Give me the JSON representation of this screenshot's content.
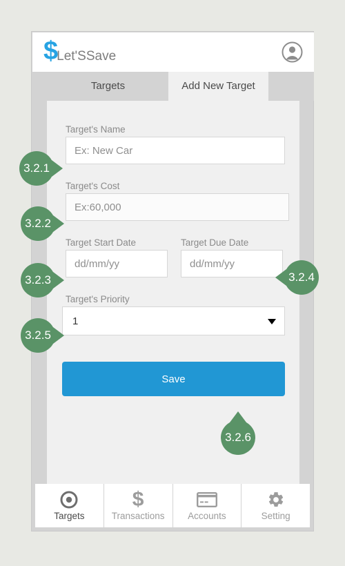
{
  "app": {
    "brand_symbol": "$",
    "brand_name": "Let'SSave",
    "avatar_icon": "user-avatar-icon"
  },
  "tabs": [
    {
      "label": "Targets",
      "active": false
    },
    {
      "label": "Add New Target",
      "active": true
    }
  ],
  "form": {
    "fields": [
      {
        "label": "Target's Name",
        "placeholder": "Ex: New Car",
        "value": ""
      },
      {
        "label": "Target's Cost",
        "placeholder": "Ex:60,000",
        "value": ""
      },
      {
        "label": "Target Start Date",
        "placeholder": "dd/mm/yy",
        "value": ""
      },
      {
        "label": "Target Due Date",
        "placeholder": "dd/mm/yy",
        "value": ""
      }
    ],
    "priority": {
      "label": "Target's Priority",
      "selected": "1",
      "caret_icon": "chevron-down-icon"
    },
    "save_label": "Save"
  },
  "bottom_nav": [
    {
      "label": "Targets",
      "icon": "target-bullseye-icon",
      "active": true
    },
    {
      "label": "Transactions",
      "icon": "dollar-sign-icon",
      "active": false
    },
    {
      "label": "Accounts",
      "icon": "credit-card-icon",
      "active": false
    },
    {
      "label": "Setting",
      "icon": "gear-icon",
      "active": false
    }
  ],
  "annotations": [
    {
      "id": "3.2.1",
      "direction": "right"
    },
    {
      "id": "3.2.2",
      "direction": "right"
    },
    {
      "id": "3.2.3",
      "direction": "right"
    },
    {
      "id": "3.2.4",
      "direction": "left"
    },
    {
      "id": "3.2.5",
      "direction": "right"
    },
    {
      "id": "3.2.6",
      "direction": "up"
    }
  ],
  "colors": {
    "brand_blue": "#27a3e3",
    "save_blue": "#2197d4",
    "annotation_green": "#5a9367",
    "page_background": "#e8e9e4",
    "frame_grey": "#d3d3d3",
    "panel_grey": "#f0f0f0"
  }
}
